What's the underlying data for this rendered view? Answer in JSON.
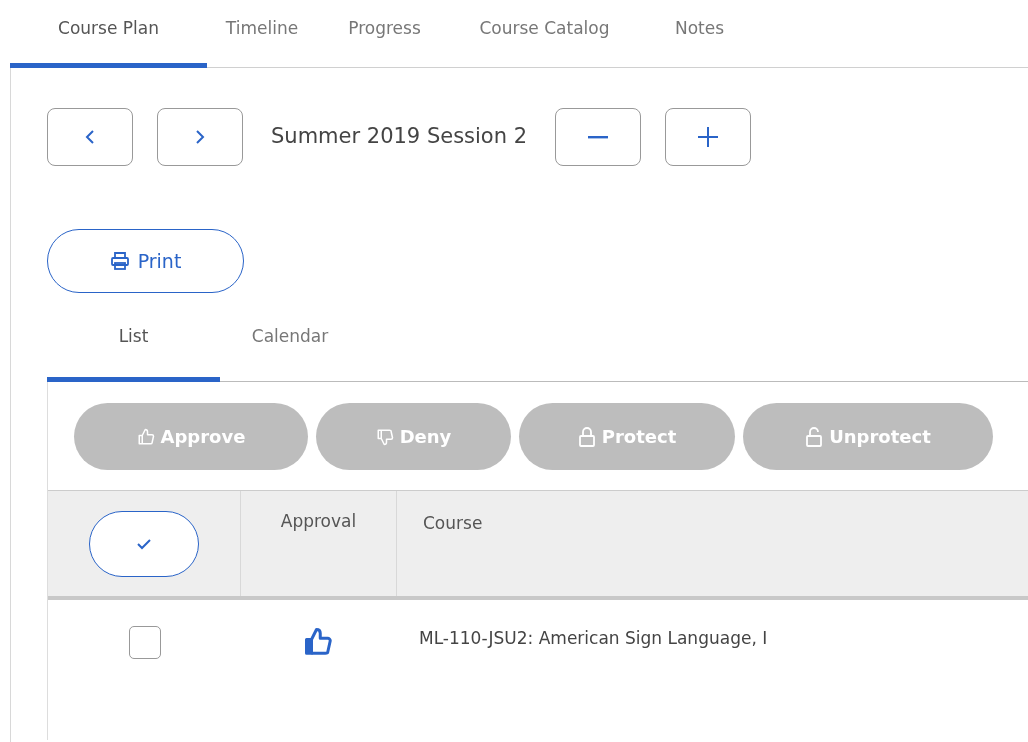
{
  "tabs": [
    {
      "label": "Course Plan",
      "selected": true
    },
    {
      "label": "Timeline",
      "selected": false
    },
    {
      "label": "Progress",
      "selected": false
    },
    {
      "label": "Course Catalog",
      "selected": false
    },
    {
      "label": "Notes",
      "selected": false
    }
  ],
  "term": {
    "title": "Summer 2019 Session 2"
  },
  "print_button": {
    "label": "Print"
  },
  "view_tabs": [
    {
      "label": "List",
      "selected": true
    },
    {
      "label": "Calendar",
      "selected": false
    }
  ],
  "actions": [
    {
      "label": "Approve",
      "kind": "approve",
      "disabled": true
    },
    {
      "label": "Deny",
      "kind": "deny",
      "disabled": true
    },
    {
      "label": "Protect",
      "kind": "protect",
      "disabled": true
    },
    {
      "label": "Unprotect",
      "kind": "unprotect",
      "disabled": true
    }
  ],
  "table": {
    "columns": [
      "Approval",
      "Course"
    ],
    "rows": [
      {
        "checked": false,
        "approved": true,
        "course": "ML-110-JSU2: American Sign Language, I"
      }
    ]
  }
}
